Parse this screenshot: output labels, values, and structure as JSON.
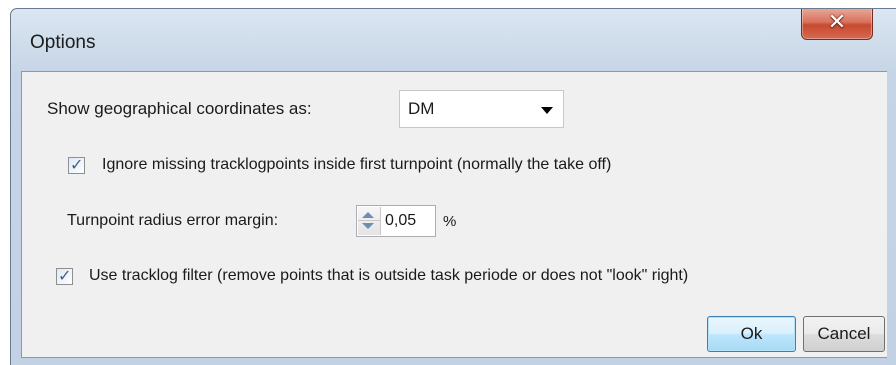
{
  "window": {
    "title": "Options",
    "close_glyph": "✕"
  },
  "coordinates": {
    "label": "Show geographical coordinates as:",
    "selected": "DM"
  },
  "ignore_missing": {
    "checked": true,
    "label": "Ignore missing tracklogpoints inside first turnpoint (normally the take off)"
  },
  "radius_margin": {
    "label": "Turnpoint radius error margin:",
    "value": "0,05",
    "unit": "%"
  },
  "tracklog_filter": {
    "checked": true,
    "label": "Use tracklog filter (remove points that is outside task periode or does not \"look\" right)"
  },
  "buttons": {
    "ok": "Ok",
    "cancel": "Cancel"
  },
  "icons": {
    "close": "close-icon",
    "dropdown": "chevron-down-icon",
    "check": "check-icon",
    "spin_up": "arrow-up-icon",
    "spin_down": "arrow-down-icon"
  },
  "colors": {
    "frame": "#c5d4e6",
    "close_button": "#c74a30",
    "client": "#f0f0f0",
    "default_button": "#bee6fd"
  }
}
